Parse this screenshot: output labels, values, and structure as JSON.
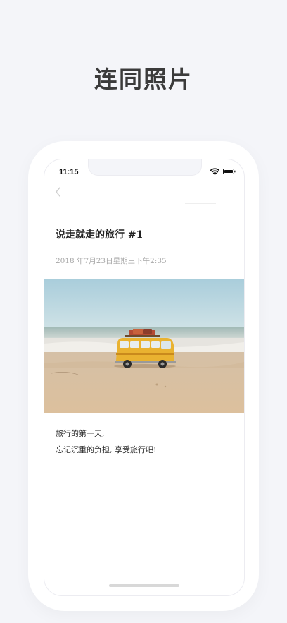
{
  "headline": "连同照片",
  "status_bar": {
    "time": "11:15",
    "wifi_icon": "wifi-icon",
    "battery_icon": "battery-icon"
  },
  "nav": {
    "back_icon": "chevron-left-icon"
  },
  "post": {
    "title": "说走就走的旅行 #1",
    "date": "2018 年7月23日星期三下午2:35",
    "body_line1": "旅行的第一天,",
    "body_line2": "忘记沉重的负担, 享受旅行吧!"
  },
  "colors": {
    "background": "#f4f5f9",
    "headline": "#3b3b3b",
    "date": "#a7a7a7",
    "sky": "#b6d4df",
    "sand": "#d9c0a1",
    "bus": "#e9b230"
  }
}
